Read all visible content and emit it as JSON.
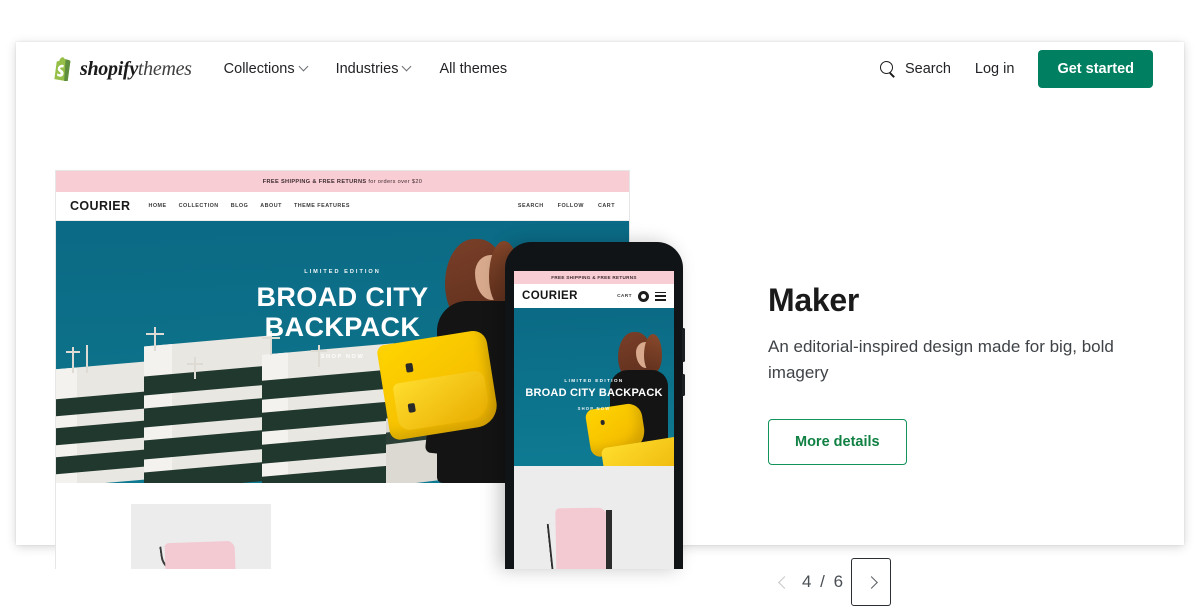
{
  "header": {
    "logo_icon": "shopify-bag-icon",
    "brand_bold": "shopify",
    "brand_light": "themes",
    "nav": [
      {
        "label": "Collections",
        "has_dropdown": true
      },
      {
        "label": "Industries",
        "has_dropdown": true
      },
      {
        "label": "All themes",
        "has_dropdown": false
      }
    ],
    "search_icon": "search-icon",
    "search_label": "Search",
    "login_label": "Log in",
    "cta_label": "Get started",
    "cta_color": "#008060"
  },
  "preview": {
    "desktop": {
      "announcement_bold": "FREE SHIPPING & FREE RETURNS",
      "announcement_rest": " for orders over $20",
      "brand": "COURIER",
      "nav_links": [
        "HOME",
        "COLLECTION",
        "BLOG",
        "ABOUT",
        "THEME FEATURES"
      ],
      "nav_right": [
        "SEARCH",
        "FOLLOW",
        "CART"
      ],
      "hero_kicker": "LIMITED EDITION",
      "hero_title_line1": "BROAD CITY",
      "hero_title_line2": "BACKPACK",
      "hero_cta": "SHOP NOW",
      "sky_color": "#0d7089",
      "announcement_color": "#f9cdd4"
    },
    "phone": {
      "announcement": "FREE SHIPPING & FREE RETURNS",
      "brand": "COURIER",
      "cart_label": "CART",
      "cart_badge_icon": "cart-badge-icon",
      "menu_icon": "hamburger-menu-icon",
      "hero_kicker": "LIMITED EDITION",
      "hero_title": "BROAD CITY BACKPACK",
      "hero_cta": "SHOP NOW"
    }
  },
  "detail": {
    "theme_name": "Maker",
    "description": "An editorial-inspired design made for big, bold imagery",
    "more_details_label": "More details",
    "accent_color": "#108043"
  },
  "pager": {
    "prev_icon": "chevron-left-icon",
    "next_icon": "chevron-right-icon",
    "count_label": "4 / 6",
    "current": 4,
    "total": 6
  }
}
